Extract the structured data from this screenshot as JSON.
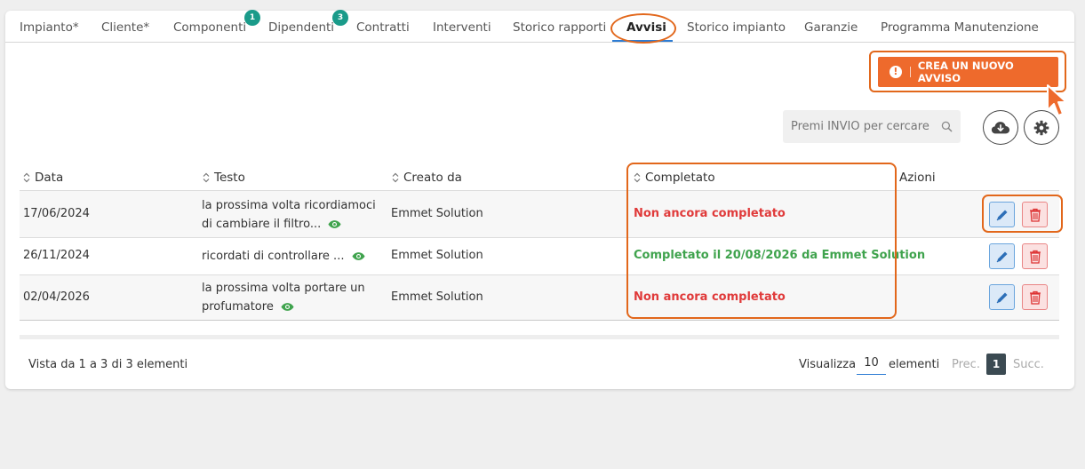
{
  "tabs": [
    {
      "label": "Impianto*"
    },
    {
      "label": "Cliente*"
    },
    {
      "label": "Componenti",
      "badge": "1"
    },
    {
      "label": "Dipendenti",
      "badge": "3"
    },
    {
      "label": "Contratti"
    },
    {
      "label": "Interventi"
    },
    {
      "label": "Storico rapporti"
    },
    {
      "label": "Avvisi",
      "active": true
    },
    {
      "label": "Storico impianto"
    },
    {
      "label": "Garanzie"
    },
    {
      "label": "Programma Manutenzione"
    }
  ],
  "toolbar": {
    "create_label": "CREA UN NUOVO AVVISO",
    "search_placeholder": "Premi INVIO per cercare",
    "download_icon": "cloud-download-icon",
    "settings_icon": "gear-icon"
  },
  "table": {
    "columns": [
      "Data",
      "Testo",
      "Creato da",
      "Completato",
      "Azioni"
    ],
    "rows": [
      {
        "data": "17/06/2024",
        "testo": "la prossima volta ricordiamoci di cambiare il filtro...",
        "creato_da": "Emmet Solution",
        "completato": "Non ancora completato",
        "status": "red"
      },
      {
        "data": "26/11/2024",
        "testo": "ricordati di controllare ...",
        "creato_da": "Emmet Solution",
        "completato": "Completato il 20/08/2026 da Emmet Solution",
        "status": "green"
      },
      {
        "data": "02/04/2026",
        "testo": "la prossima volta portare un profumatore",
        "creato_da": "Emmet Solution",
        "completato": "Non ancora completato",
        "status": "red"
      }
    ]
  },
  "footer": {
    "info": "Vista da 1 a 3 di 3 elementi",
    "show_label": "Visualizza",
    "page_length": "10",
    "elements_label": "elementi",
    "prev": "Prec.",
    "current_page": "1",
    "next": "Succ."
  },
  "colors": {
    "accent": "#ee6a2c",
    "highlight_ring": "#e2671b",
    "badge": "#1a9b8a",
    "not_completed": "#e03a3a",
    "completed": "#3fa34d"
  }
}
